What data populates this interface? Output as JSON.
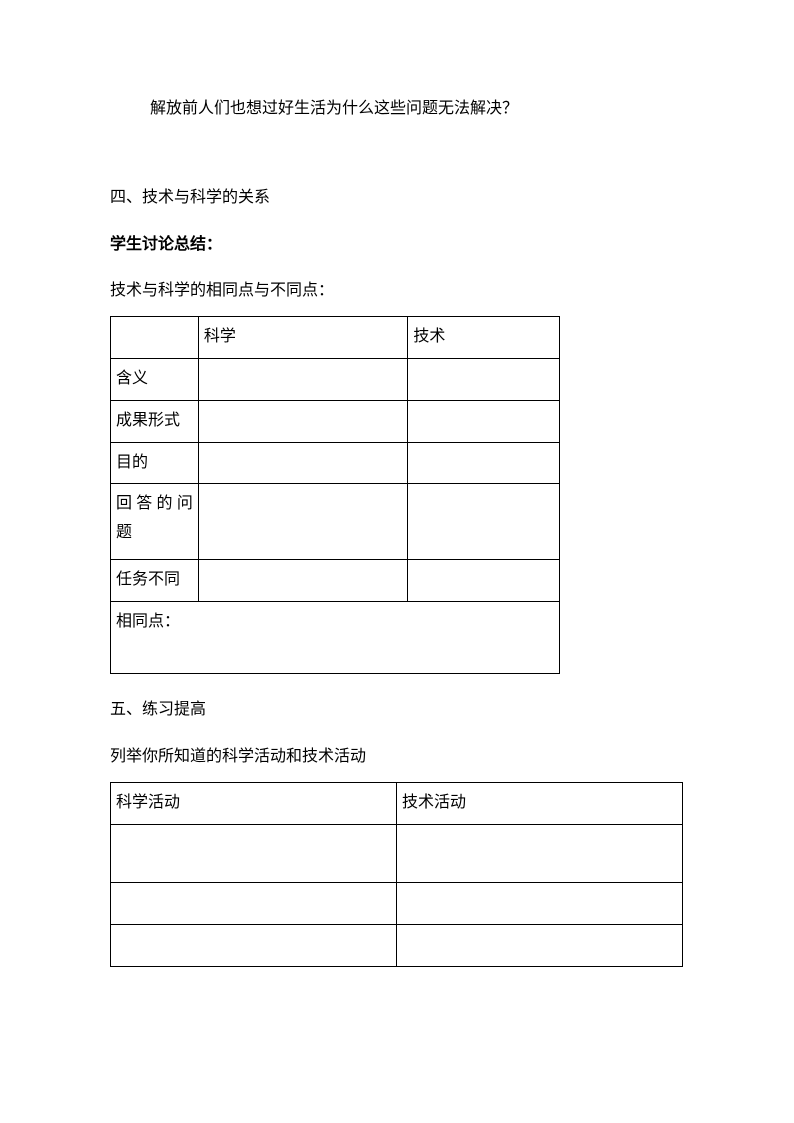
{
  "top_line": "解放前人们也想过好生活为什么这些问题无法解决？",
  "section4": {
    "title": "四、技术与科学的关系",
    "bold": "学生讨论总结：",
    "intro": "技术与科学的相同点与不同点：",
    "table": {
      "headers": {
        "col1": "",
        "col2": "科学",
        "col3": "技术"
      },
      "rows": [
        {
          "label": "含义",
          "c2": "",
          "c3": ""
        },
        {
          "label": "成果形式",
          "c2": "",
          "c3": ""
        },
        {
          "label": "目的",
          "c2": "",
          "c3": ""
        },
        {
          "label": "回答的问题",
          "c2": "",
          "c3": ""
        },
        {
          "label": "任务不同",
          "c2": "",
          "c3": ""
        }
      ],
      "last_row": "相同点："
    }
  },
  "section5": {
    "title": "五、练习提高",
    "intro": "列举你所知道的科学活动和技术活动",
    "table": {
      "headers": {
        "col1": "科学活动",
        "col2": "技术活动"
      },
      "rows": [
        {
          "a": "",
          "b": ""
        },
        {
          "a": "",
          "b": ""
        },
        {
          "a": "",
          "b": ""
        }
      ]
    }
  }
}
